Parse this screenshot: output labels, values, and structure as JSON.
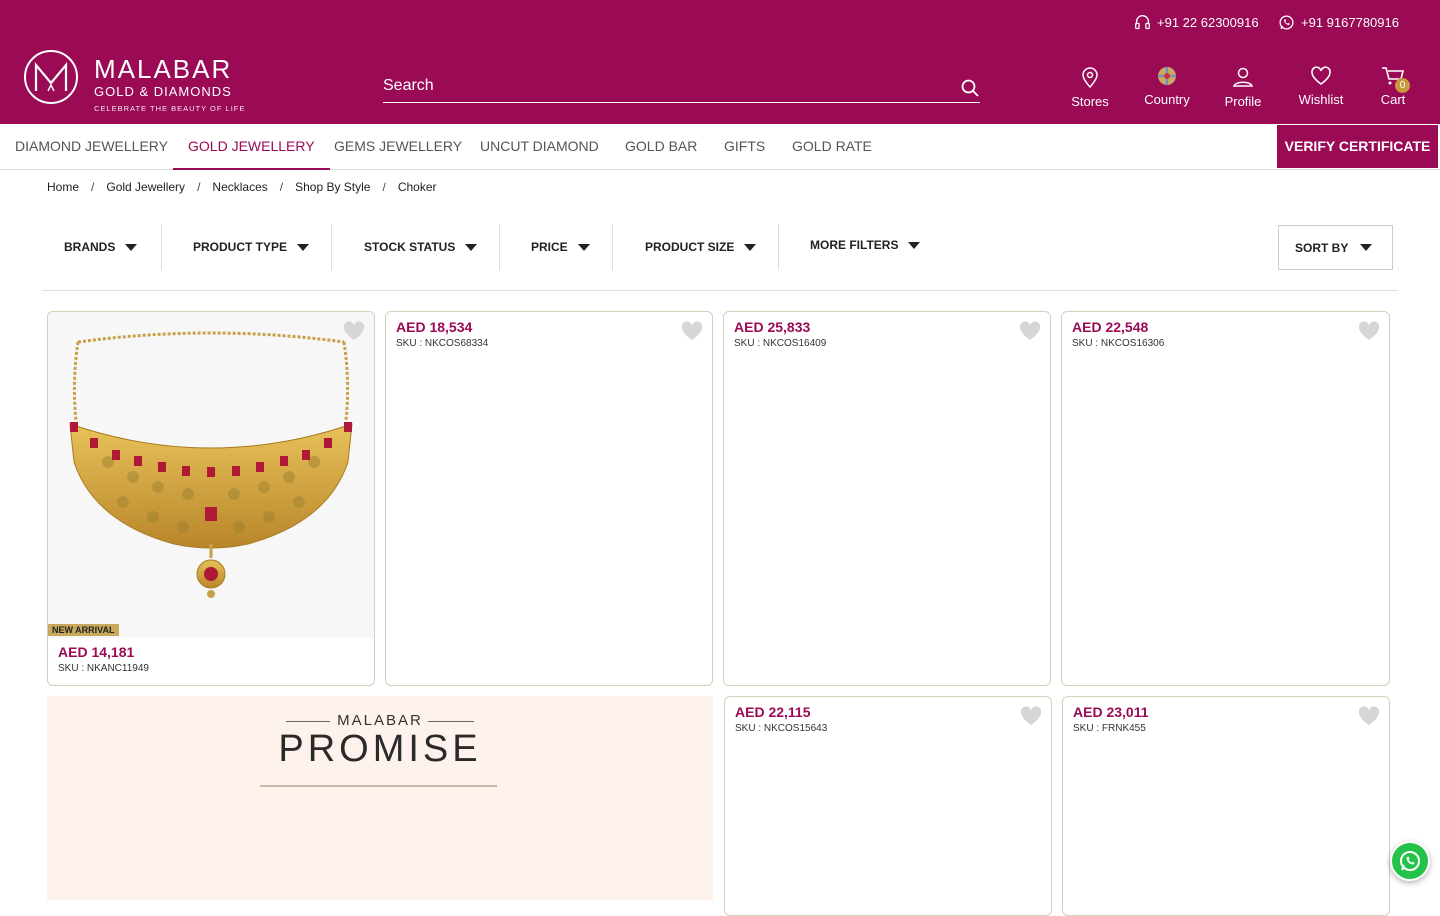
{
  "header": {
    "phone_support": "+91 22 62300916",
    "phone_whatsapp": "+91 9167780916",
    "logo_brand": "MALABAR",
    "logo_sub": "GOLD & DIAMONDS",
    "logo_tagline": "CELEBRATE THE BEAUTY OF LIFE",
    "search_placeholder": "Search",
    "icons": {
      "stores": "Stores",
      "country": "Country",
      "profile": "Profile",
      "wishlist": "Wishlist",
      "cart": "Cart",
      "cart_count": "0"
    }
  },
  "nav": {
    "items": [
      "DIAMOND JEWELLERY",
      "GOLD JEWELLERY",
      "GEMS JEWELLERY",
      "UNCUT DIAMOND",
      "GOLD BAR",
      "GIFTS",
      "GOLD RATE"
    ],
    "active": "GOLD JEWELLERY",
    "verify": "VERIFY CERTIFICATE"
  },
  "breadcrumb": [
    "Home",
    "Gold Jewellery",
    "Necklaces",
    "Shop By Style",
    "Choker"
  ],
  "filters": {
    "items": [
      "BRANDS",
      "PRODUCT TYPE",
      "STOCK STATUS",
      "PRICE",
      "PRODUCT SIZE",
      "MORE FILTERS"
    ],
    "sort": "SORT BY"
  },
  "products": [
    {
      "price": "AED 14,181",
      "sku": "SKU : NKANC11949",
      "badge": "NEW ARRIVAL"
    },
    {
      "price": "AED 18,534",
      "sku": "SKU : NKCOS68334"
    },
    {
      "price": "AED 25,833",
      "sku": "SKU : NKCOS16409"
    },
    {
      "price": "AED 22,548",
      "sku": "SKU : NKCOS16306"
    },
    {
      "price": "AED 22,115",
      "sku": "SKU : NKCOS15643"
    },
    {
      "price": "AED 23,011",
      "sku": "SKU : FRNK455"
    }
  ],
  "promise": {
    "small": "MALABAR",
    "big": "PROMISE"
  },
  "colors": {
    "brand": "#9a0a55",
    "gold": "#c8a95b",
    "whatsapp": "#25c24a"
  }
}
